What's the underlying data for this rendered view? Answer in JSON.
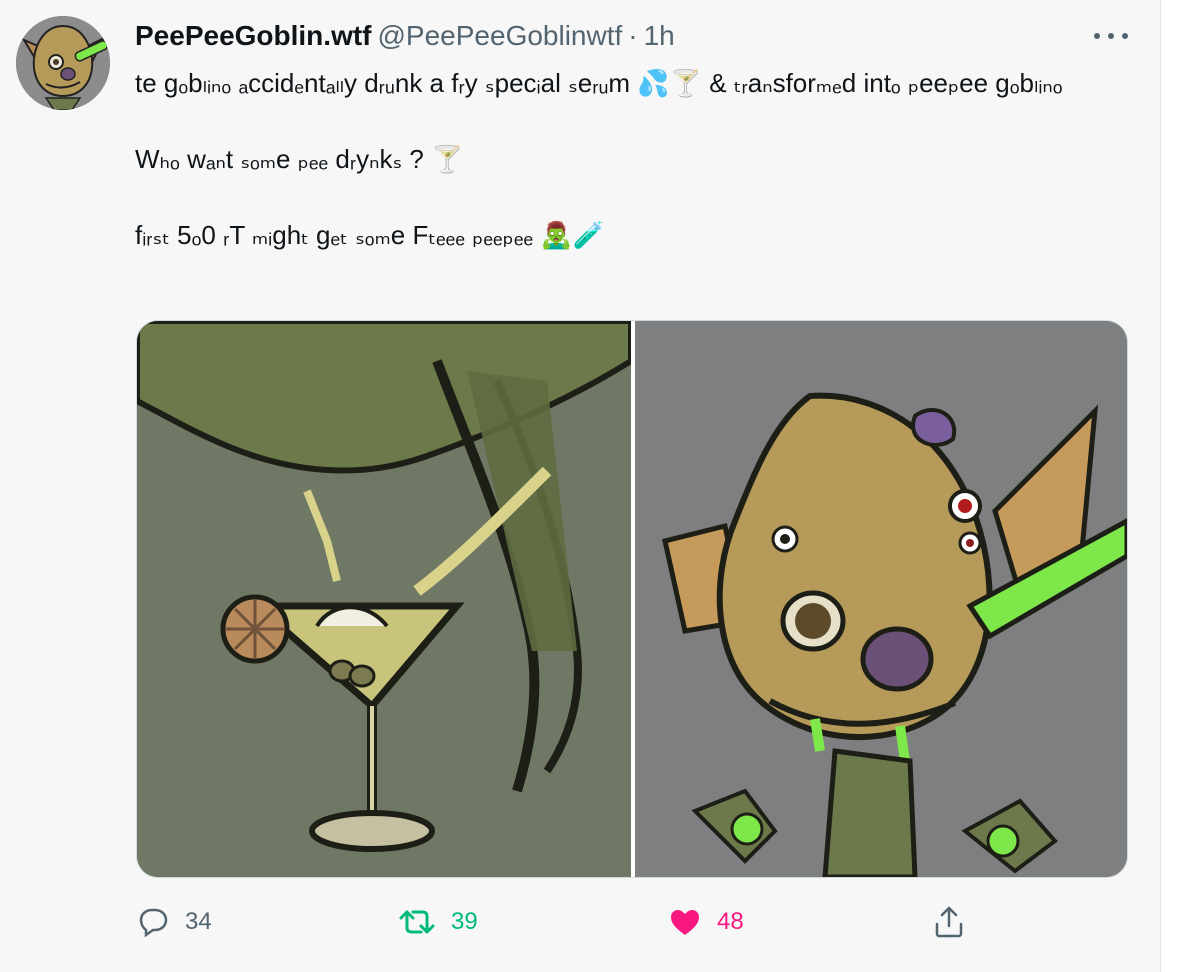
{
  "tweet": {
    "display_name": "PeePeeGoblin.wtf",
    "handle": "@PeePeeGoblinwtf",
    "separator": "·",
    "time": "1h",
    "line1_text": "te gₒbₗᵢₙₒ ₐccidₑntₐₗₗy dᵣᵤnk a fᵣy ₛpecᵢal ₛeᵣᵤm",
    "line1_emoji": "💦🍸",
    "line1_cont": " & ₜᵣaₙsforₘₑd intₒ ₚeeₚee gₒbₗᵢₙₒ",
    "line2_text": "Wₕₒ wₐₙt ₛₒₘe ₚₑₑ dᵣyₙkₛ ? ",
    "line2_emoji": "🍸",
    "line3_text": "fᵢᵣₛₜ 5ₒ0 ᵣT ₘᵢghₜ gₑₜ ₛₒₘe Fₜₑₑₑ ₚₑₑₚₑₑ ",
    "line3_emoji": "🧟‍♂️🧪",
    "more_icon": "more-icon",
    "media": [
      {
        "name": "cocktail-illustration",
        "colors": {
          "bg": "#6f7765",
          "stroke": "#1d1f17",
          "drink": "#d8d28a"
        }
      },
      {
        "name": "goblin-illustration",
        "colors": {
          "bg": "#7e7f80",
          "skin": "#b59a5a",
          "nose": "#6b5078",
          "slime": "#7ee84a"
        }
      }
    ],
    "actions": {
      "reply": {
        "icon": "reply-icon",
        "count": "34",
        "color": "#536471"
      },
      "retweet": {
        "icon": "retweet-icon",
        "count": "39",
        "color": "#00ba7c"
      },
      "like": {
        "icon": "heart-icon",
        "count": "48",
        "color": "#f91880"
      },
      "share": {
        "icon": "share-icon",
        "color": "#536471"
      }
    }
  }
}
